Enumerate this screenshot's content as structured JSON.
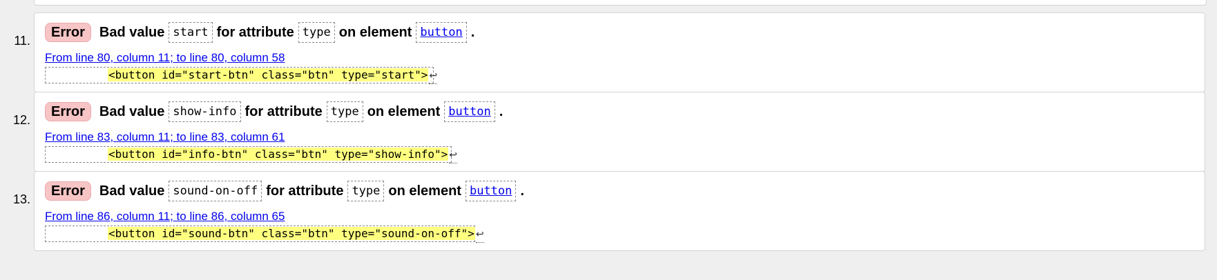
{
  "entries": [
    {
      "number": "11.",
      "badge": "Error",
      "text_bad_value": "Bad value",
      "value": "start",
      "text_for_attribute": "for attribute",
      "attribute": "type",
      "text_on_element": "on element",
      "element": "button",
      "period": ".",
      "location": "From line 80, column 11; to line 80, column 58",
      "extract": "<button id=\"start-btn\" class=\"btn\" type=\"start\">",
      "return_glyph": "↩"
    },
    {
      "number": "12.",
      "badge": "Error",
      "text_bad_value": "Bad value",
      "value": "show-info",
      "text_for_attribute": "for attribute",
      "attribute": "type",
      "text_on_element": "on element",
      "element": "button",
      "period": ".",
      "location": "From line 83, column 11; to line 83, column 61",
      "extract": "<button id=\"info-btn\" class=\"btn\" type=\"show-info\">",
      "return_glyph": "↩"
    },
    {
      "number": "13.",
      "badge": "Error",
      "text_bad_value": "Bad value",
      "value": "sound-on-off",
      "text_for_attribute": "for attribute",
      "attribute": "type",
      "text_on_element": "on element",
      "element": "button",
      "period": ".",
      "location": "From line 86, column 11; to line 86, column 65",
      "extract": "<button id=\"sound-btn\" class=\"btn\" type=\"sound-on-off\">",
      "return_glyph": "↩"
    }
  ]
}
